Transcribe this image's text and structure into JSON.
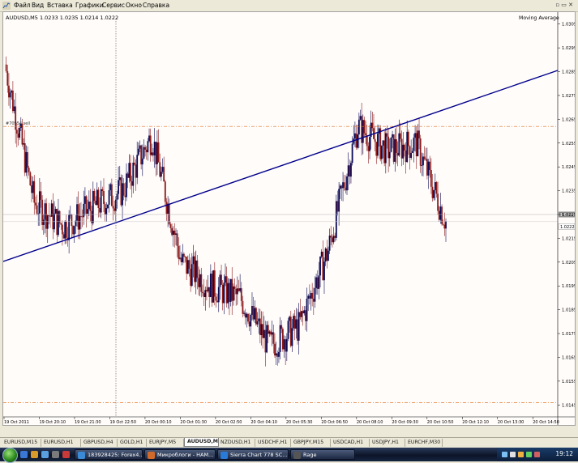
{
  "menu": [
    "Файл",
    "Вид",
    "Вставка",
    "Графики",
    "Сервис",
    "Окно",
    "Справка"
  ],
  "chart": {
    "info_label": "AUDUSD,M5  1.0233 1.0235 1.0214 1.0222",
    "indicator_label": "Moving Average",
    "price_labels": [
      "1.0305",
      "1.0295",
      "1.0285",
      "1.0275",
      "1.0265",
      "1.0255",
      "1.0245",
      "1.0235",
      "1.0225",
      "1.0215",
      "1.0205",
      "1.0195",
      "1.0185",
      "1.0175",
      "1.0165",
      "1.0155",
      "1.0145"
    ],
    "current_price_tag": "1.0225",
    "bid_price_tag": "1.0222",
    "time_labels": [
      "19 Oct 2011",
      "19 Oct 20:10",
      "19 Oct 21:30",
      "19 Oct 22:50",
      "20 Oct 00:10",
      "20 Oct 01:30",
      "20 Oct 02:50",
      "20 Oct 04:10",
      "20 Oct 05:30",
      "20 Oct 06:50",
      "20 Oct 08:10",
      "20 Oct 09:30",
      "20 Oct 10:50",
      "20 Oct 12:10",
      "20 Oct 13:30",
      "20 Oct 14:50"
    ],
    "object_label": "#70954 sell",
    "colors": {
      "bull": "#0a0a55",
      "bear": "#8b1a1a",
      "trendline": "#00008b",
      "level": "#e07020",
      "price_line": "#b0b0b0"
    }
  },
  "chart_data": {
    "type": "candlestick",
    "symbol": "AUDUSD",
    "timeframe": "M5",
    "ylim": [
      1.014,
      1.031
    ],
    "close_path_points": [
      {
        "t": "19 Oct 2011",
        "price": 1.0288
      },
      {
        "t": "19 Oct 20:10",
        "price": 1.023
      },
      {
        "t": "19 Oct 21:30",
        "price": 1.022
      },
      {
        "t": "19 Oct 22:50",
        "price": 1.0228
      },
      {
        "t": "20 Oct 00:10",
        "price": 1.0235
      },
      {
        "t": "20 Oct 01:30",
        "price": 1.0258
      },
      {
        "t": "20 Oct 02:50",
        "price": 1.0205
      },
      {
        "t": "20 Oct 04:10",
        "price": 1.0195
      },
      {
        "t": "20 Oct 05:30",
        "price": 1.019
      },
      {
        "t": "20 Oct 06:50",
        "price": 1.017
      },
      {
        "t": "20 Oct 08:10",
        "price": 1.0178
      },
      {
        "t": "20 Oct 09:30",
        "price": 1.021
      },
      {
        "t": "20 Oct 10:50",
        "price": 1.0262
      },
      {
        "t": "20 Oct 12:10",
        "price": 1.0252
      },
      {
        "t": "20 Oct 13:30",
        "price": 1.0255
      },
      {
        "t": "20 Oct 14:50",
        "price": 1.0222
      }
    ],
    "levels": [
      1.0262,
      1.0146
    ],
    "current_price": 1.0225,
    "bid_price": 1.0222
  },
  "tabs": [
    {
      "label": "EURUSD,M15",
      "active": false
    },
    {
      "label": "EURUSD,H1",
      "active": false
    },
    {
      "label": "GBPUSD,H4",
      "active": false
    },
    {
      "label": "GOLD,H1",
      "active": false
    },
    {
      "label": "EURJPY,M5",
      "active": false
    },
    {
      "label": "AUDUSD,M5",
      "active": true
    },
    {
      "label": "NZDUSD,H1",
      "active": false
    },
    {
      "label": "USDCHF,H1",
      "active": false
    },
    {
      "label": "GBPJPY,M15",
      "active": false
    },
    {
      "label": "USDCAD,H1",
      "active": false
    },
    {
      "label": "USDJPY,H1",
      "active": false
    },
    {
      "label": "EURCHF,M30",
      "active": false
    }
  ],
  "taskbar": {
    "buttons": [
      "183928425: Forex4...",
      "Микроблоги - НАМ...",
      "Sierra Chart 778 SC...",
      "Rage"
    ],
    "clock": "19:12"
  }
}
